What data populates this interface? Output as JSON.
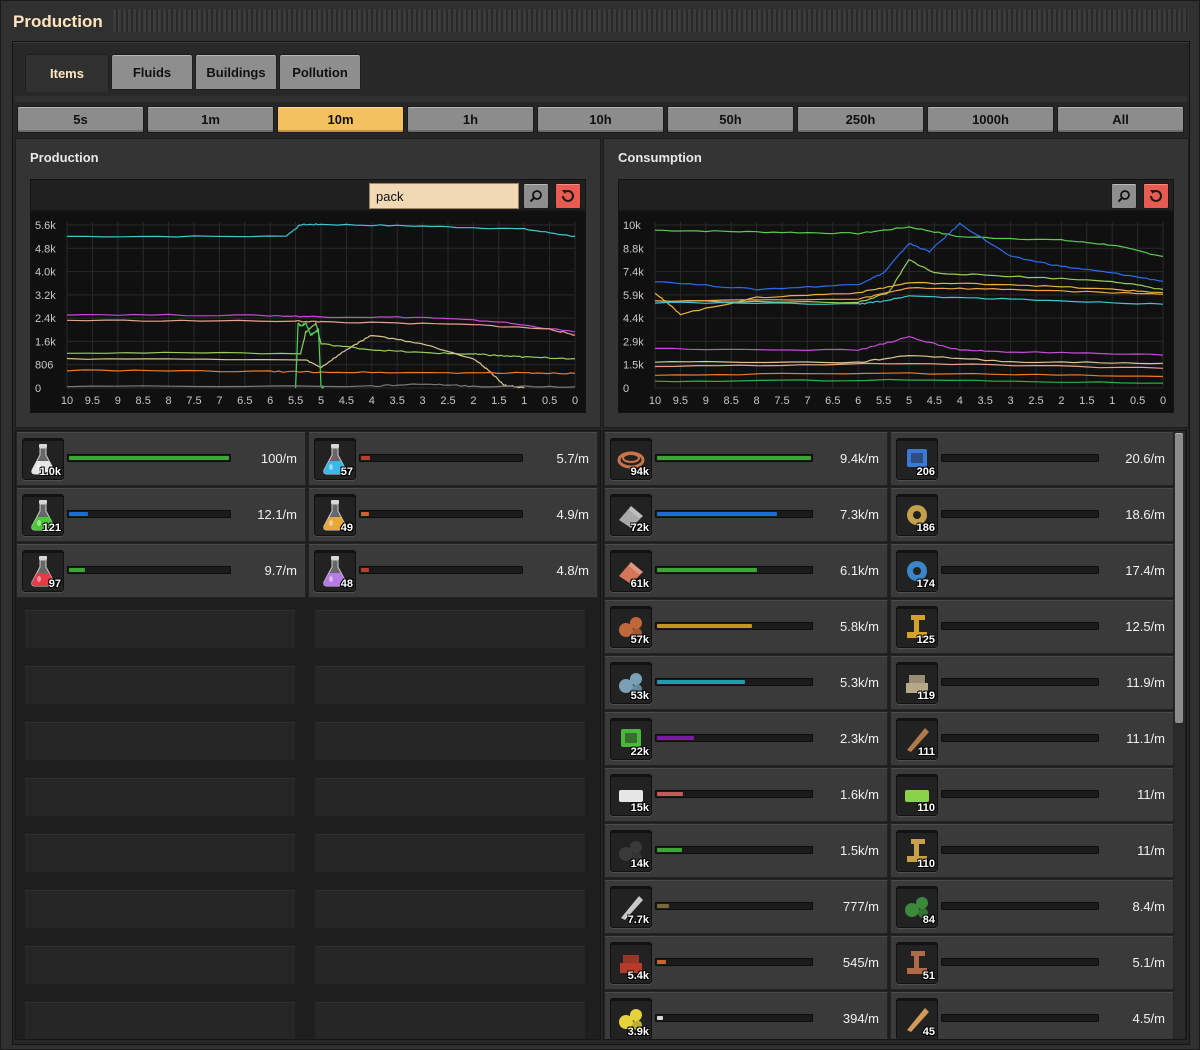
{
  "window": {
    "title": "Production"
  },
  "tabs": [
    {
      "label": "Items",
      "active": true
    },
    {
      "label": "Fluids",
      "active": false
    },
    {
      "label": "Buildings",
      "active": false
    },
    {
      "label": "Pollution",
      "active": false
    }
  ],
  "time_ranges": [
    {
      "label": "5s",
      "active": false
    },
    {
      "label": "1m",
      "active": false
    },
    {
      "label": "10m",
      "active": true
    },
    {
      "label": "1h",
      "active": false
    },
    {
      "label": "10h",
      "active": false
    },
    {
      "label": "50h",
      "active": false
    },
    {
      "label": "250h",
      "active": false
    },
    {
      "label": "1000h",
      "active": false
    },
    {
      "label": "All",
      "active": false
    }
  ],
  "production": {
    "title": "Production",
    "search_value": "pack",
    "chart_data": {
      "type": "line",
      "yticks": [
        "5.6k",
        "4.8k",
        "4.0k",
        "3.2k",
        "2.4k",
        "1.6k",
        "806",
        "0"
      ],
      "ylim": [
        0,
        5640
      ],
      "xticks": [
        "10",
        "9.5",
        "9",
        "8.5",
        "8",
        "7.5",
        "7",
        "6.5",
        "6",
        "5.5",
        "5",
        "4.5",
        "4",
        "3.5",
        "3",
        "2.5",
        "2",
        "1.5",
        "1",
        "0.5",
        "0"
      ],
      "xlim": [
        10,
        0
      ],
      "series": [
        {
          "color": "#3fc6d4",
          "x": [
            10,
            5.7,
            5.4,
            5,
            3,
            1,
            0
          ],
          "y": [
            5150,
            5150,
            5550,
            5560,
            5500,
            5400,
            5150
          ]
        },
        {
          "color": "#c64bd6",
          "x": [
            10,
            6,
            5,
            3,
            1.5,
            0
          ],
          "y": [
            2500,
            2460,
            2420,
            2400,
            2250,
            1900
          ]
        },
        {
          "color": "#e8a28c",
          "x": [
            10,
            5.5,
            5,
            2,
            0.5,
            0
          ],
          "y": [
            2300,
            2270,
            2250,
            2150,
            2000,
            1800
          ]
        },
        {
          "color": "#9acc5a",
          "x": [
            10,
            5.4,
            5.3,
            5.1,
            5,
            4,
            3,
            2,
            1.5,
            1,
            0
          ],
          "y": [
            1200,
            1180,
            1900,
            2200,
            1500,
            1300,
            1200,
            1150,
            1100,
            1050,
            1000
          ]
        },
        {
          "color": "#d6c88f",
          "x": [
            10,
            5.3,
            5,
            4.5,
            4,
            3,
            2,
            1.7,
            1.4,
            1
          ],
          "y": [
            1000,
            950,
            700,
            1300,
            1800,
            1500,
            1000,
            600,
            100,
            0
          ]
        },
        {
          "color": "#e87a2a",
          "x": [
            10,
            6,
            5,
            3,
            1,
            0
          ],
          "y": [
            600,
            560,
            540,
            520,
            510,
            500
          ]
        },
        {
          "color": "#4bd65a",
          "x": [
            5.5,
            5.45,
            5.4,
            5.3,
            5.2,
            5.1,
            5.05,
            5.0,
            4.95
          ],
          "y": [
            0,
            2200,
            2100,
            2200,
            1800,
            1900,
            2000,
            50,
            0
          ]
        },
        {
          "color": "#7c7c7c",
          "x": [
            10,
            4,
            3,
            2,
            0
          ],
          "y": [
            60,
            60,
            140,
            60,
            40
          ]
        }
      ]
    },
    "items": [
      {
        "icon": "automation-science-pack-icon",
        "count": "1.0k",
        "rate": "100/m",
        "fill": 1.0,
        "color": "#3fa636"
      },
      {
        "icon": "chemical-science-pack-icon",
        "count": "57",
        "rate": "5.7/m",
        "fill": 0.057,
        "color": "#c43a2a"
      },
      {
        "icon": "logistic-science-pack-icon",
        "count": "121",
        "rate": "12.1/m",
        "fill": 0.121,
        "color": "#1f6ad6"
      },
      {
        "icon": "production-science-pack-icon",
        "count": "49",
        "rate": "4.9/m",
        "fill": 0.049,
        "color": "#d2622a"
      },
      {
        "icon": "military-science-pack-icon",
        "count": "97",
        "rate": "9.7/m",
        "fill": 0.097,
        "color": "#3fa636"
      },
      {
        "icon": "utility-science-pack-icon",
        "count": "48",
        "rate": "4.8/m",
        "fill": 0.048,
        "color": "#c43a2a"
      }
    ]
  },
  "consumption": {
    "title": "Consumption",
    "chart_data": {
      "type": "line",
      "yticks": [
        "10k",
        "8.8k",
        "7.4k",
        "5.9k",
        "4.4k",
        "2.9k",
        "1.5k",
        "0"
      ],
      "ylim": [
        0,
        10100
      ],
      "xticks": [
        "10",
        "9.5",
        "9",
        "8.5",
        "8",
        "7.5",
        "7",
        "6.5",
        "6",
        "5.5",
        "5",
        "4.5",
        "4",
        "3.5",
        "3",
        "2.5",
        "2",
        "1.5",
        "1",
        "0.5",
        "0"
      ],
      "xlim": [
        10,
        0
      ],
      "series": [
        {
          "color": "#5acc4f",
          "x": [
            10,
            8,
            6,
            5,
            4,
            2,
            1,
            0
          ],
          "y": [
            9600,
            9500,
            9400,
            9800,
            9200,
            9000,
            8700,
            8000
          ]
        },
        {
          "color": "#2a6fe8",
          "x": [
            10,
            8,
            6,
            5.5,
            5,
            4.6,
            4,
            3,
            2,
            1,
            0
          ],
          "y": [
            6500,
            6000,
            6300,
            7000,
            8800,
            8300,
            10000,
            8000,
            7400,
            7000,
            6500
          ]
        },
        {
          "color": "#9acc5a",
          "x": [
            10,
            6,
            5.4,
            5,
            4.5,
            3,
            1,
            0
          ],
          "y": [
            5300,
            5200,
            5800,
            7800,
            7000,
            6800,
            6500,
            6000
          ]
        },
        {
          "color": "#e8b23c",
          "x": [
            10,
            9.5,
            8,
            6,
            5,
            3,
            1,
            0
          ],
          "y": [
            5800,
            4500,
            5500,
            5800,
            6400,
            6300,
            6000,
            5800
          ]
        },
        {
          "color": "#f0a24a",
          "x": [
            10,
            6,
            5,
            3,
            0
          ],
          "y": [
            5300,
            5400,
            6100,
            6000,
            5700
          ]
        },
        {
          "color": "#3fc6d4",
          "x": [
            10,
            6,
            5.5,
            5,
            3,
            0
          ],
          "y": [
            5200,
            5100,
            5300,
            5600,
            5400,
            5100
          ]
        },
        {
          "color": "#c64bd6",
          "x": [
            10,
            6,
            5,
            4,
            3,
            0
          ],
          "y": [
            2400,
            2300,
            3100,
            2300,
            2200,
            2000
          ]
        },
        {
          "color": "#d6c88f",
          "x": [
            10,
            6,
            5,
            3,
            0
          ],
          "y": [
            1600,
            1550,
            2000,
            1600,
            1500
          ]
        },
        {
          "color": "#e8a28c",
          "x": [
            10,
            5,
            0
          ],
          "y": [
            1300,
            1500,
            1200
          ]
        },
        {
          "color": "#e87a2a",
          "x": [
            10,
            5,
            0
          ],
          "y": [
            800,
            900,
            700
          ]
        },
        {
          "color": "#2bb34a",
          "x": [
            10,
            5,
            0
          ],
          "y": [
            400,
            500,
            300
          ]
        }
      ]
    },
    "items": [
      {
        "icon": "copper-cable-icon",
        "count": "94k",
        "rate": "9.4k/m",
        "fill": 1.0,
        "color": "#3fa636"
      },
      {
        "icon": "processing-unit-icon",
        "count": "206",
        "rate": "20.6/m",
        "fill": 0.0,
        "color": "#3fa636"
      },
      {
        "icon": "iron-plate-icon",
        "count": "72k",
        "rate": "7.3k/m",
        "fill": 0.78,
        "color": "#1f6ad6"
      },
      {
        "icon": "engine-unit-icon",
        "count": "186",
        "rate": "18.6/m",
        "fill": 0.0,
        "color": "#3fa636"
      },
      {
        "icon": "copper-plate-icon",
        "count": "61k",
        "rate": "6.1k/m",
        "fill": 0.65,
        "color": "#3fa636"
      },
      {
        "icon": "electric-engine-unit-icon",
        "count": "174",
        "rate": "17.4/m",
        "fill": 0.0,
        "color": "#3fa636"
      },
      {
        "icon": "copper-ore-icon",
        "count": "57k",
        "rate": "5.8k/m",
        "fill": 0.62,
        "color": "#c4941f"
      },
      {
        "icon": "inserter-icon",
        "count": "125",
        "rate": "12.5/m",
        "fill": 0.0,
        "color": "#3fa636"
      },
      {
        "icon": "iron-ore-icon",
        "count": "53k",
        "rate": "5.3k/m",
        "fill": 0.57,
        "color": "#1a9fae"
      },
      {
        "icon": "stone-brick-icon",
        "count": "119",
        "rate": "11.9/m",
        "fill": 0.0,
        "color": "#3fa636"
      },
      {
        "icon": "electronic-circuit-icon",
        "count": "22k",
        "rate": "2.3k/m",
        "fill": 0.24,
        "color": "#7a1aa6"
      },
      {
        "icon": "pipe-icon",
        "count": "111",
        "rate": "11.1/m",
        "fill": 0.0,
        "color": "#3fa636"
      },
      {
        "icon": "plastic-bar-icon",
        "count": "15k",
        "rate": "1.6k/m",
        "fill": 0.17,
        "color": "#c45a5a"
      },
      {
        "icon": "battery-icon",
        "count": "110",
        "rate": "11/m",
        "fill": 0.0,
        "color": "#3fa636"
      },
      {
        "icon": "coal-icon",
        "count": "14k",
        "rate": "1.5k/m",
        "fill": 0.16,
        "color": "#3fa636"
      },
      {
        "icon": "transport-belt-icon",
        "count": "110",
        "rate": "11/m",
        "fill": 0.0,
        "color": "#3fa636"
      },
      {
        "icon": "steel-plate-icon",
        "count": "7.7k",
        "rate": "777/m",
        "fill": 0.08,
        "color": "#7a6a3a"
      },
      {
        "icon": "wood-icon",
        "count": "84",
        "rate": "8.4/m",
        "fill": 0.0,
        "color": "#3fa636"
      },
      {
        "icon": "grenade-icon",
        "count": "5.4k",
        "rate": "545/m",
        "fill": 0.06,
        "color": "#d2622a"
      },
      {
        "icon": "gun-turret-icon",
        "count": "51",
        "rate": "5.1/m",
        "fill": 0.0,
        "color": "#3fa636"
      },
      {
        "icon": "sulfur-icon",
        "count": "3.9k",
        "rate": "394/m",
        "fill": 0.04,
        "color": "#d8d8d8"
      },
      {
        "icon": "firearm-magazine-icon",
        "count": "45",
        "rate": "4.5/m",
        "fill": 0.0,
        "color": "#3fa636"
      }
    ]
  }
}
